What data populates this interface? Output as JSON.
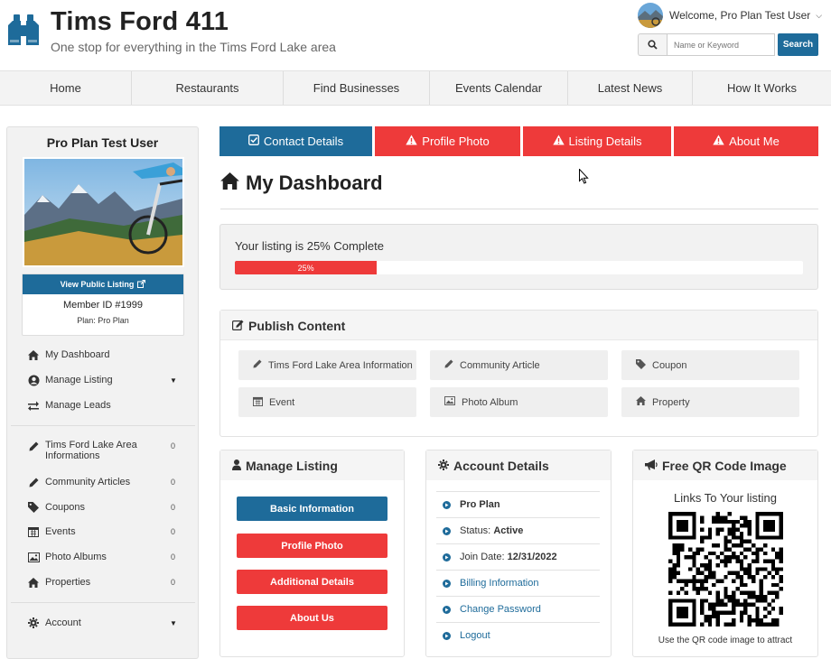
{
  "header": {
    "title": "Tims Ford 411",
    "tagline": "One stop for everything in the Tims Ford Lake area",
    "welcome": "Welcome, Pro Plan Test User",
    "search_placeholder": "Name or Keyword",
    "search_button": "Search"
  },
  "nav": {
    "items": [
      {
        "label": "Home"
      },
      {
        "label": "Restaurants"
      },
      {
        "label": "Find Businesses"
      },
      {
        "label": "Events Calendar"
      },
      {
        "label": "Latest News"
      },
      {
        "label": "How It Works"
      }
    ]
  },
  "sidebar": {
    "user_name": "Pro Plan Test User",
    "view_public": "View Public Listing",
    "member_id": "Member ID #1999",
    "plan": "Plan: Pro Plan",
    "menu": [
      {
        "label": "My Dashboard",
        "icon": "home-icon"
      },
      {
        "label": "Manage Listing",
        "icon": "user-circle-icon"
      },
      {
        "label": "Manage Leads",
        "icon": "swap-icon"
      }
    ],
    "content": [
      {
        "label": "Tims Ford Lake Area Informations",
        "count": "0",
        "icon": "pencil-icon"
      },
      {
        "label": "Community Articles",
        "count": "0",
        "icon": "pencil-icon"
      },
      {
        "label": "Coupons",
        "count": "0",
        "icon": "tag-icon"
      },
      {
        "label": "Events",
        "count": "0",
        "icon": "calendar-icon"
      },
      {
        "label": "Photo Albums",
        "count": "0",
        "icon": "image-icon"
      },
      {
        "label": "Properties",
        "count": "0",
        "icon": "home-icon"
      }
    ],
    "account": "Account"
  },
  "tabs": [
    {
      "label": "Contact Details",
      "status": "done"
    },
    {
      "label": "Profile Photo",
      "status": "warning"
    },
    {
      "label": "Listing Details",
      "status": "warning"
    },
    {
      "label": "About Me",
      "status": "warning"
    }
  ],
  "dashboard": {
    "title": "My Dashboard",
    "progress_text": "Your listing is 25% Complete",
    "progress_label": "25%",
    "progress_value": 0.25
  },
  "publish": {
    "title": "Publish Content",
    "items": [
      {
        "label": "Tims Ford Lake Area Information",
        "icon": "pencil-icon"
      },
      {
        "label": "Community Article",
        "icon": "pencil-icon"
      },
      {
        "label": "Coupon",
        "icon": "tag-icon"
      },
      {
        "label": "Event",
        "icon": "calendar-icon"
      },
      {
        "label": "Photo Album",
        "icon": "image-icon"
      },
      {
        "label": "Property",
        "icon": "home-icon"
      }
    ]
  },
  "manage_listing": {
    "title": "Manage Listing",
    "buttons": [
      "Basic Information",
      "Profile Photo",
      "Additional Details",
      "About Us"
    ]
  },
  "account_details": {
    "title": "Account Details",
    "plan": "Pro Plan",
    "status_label": "Status:",
    "status_value": "Active",
    "join_label": "Join Date:",
    "join_value": "12/31/2022",
    "billing": "Billing Information",
    "change_password": "Change Password",
    "logout": "Logout"
  },
  "qr": {
    "title": "Free QR Code Image",
    "heading": "Links To Your listing",
    "note": "Use the QR code image to attract"
  },
  "colors": {
    "primary": "#1e6b9a",
    "danger": "#ee3a3a"
  }
}
